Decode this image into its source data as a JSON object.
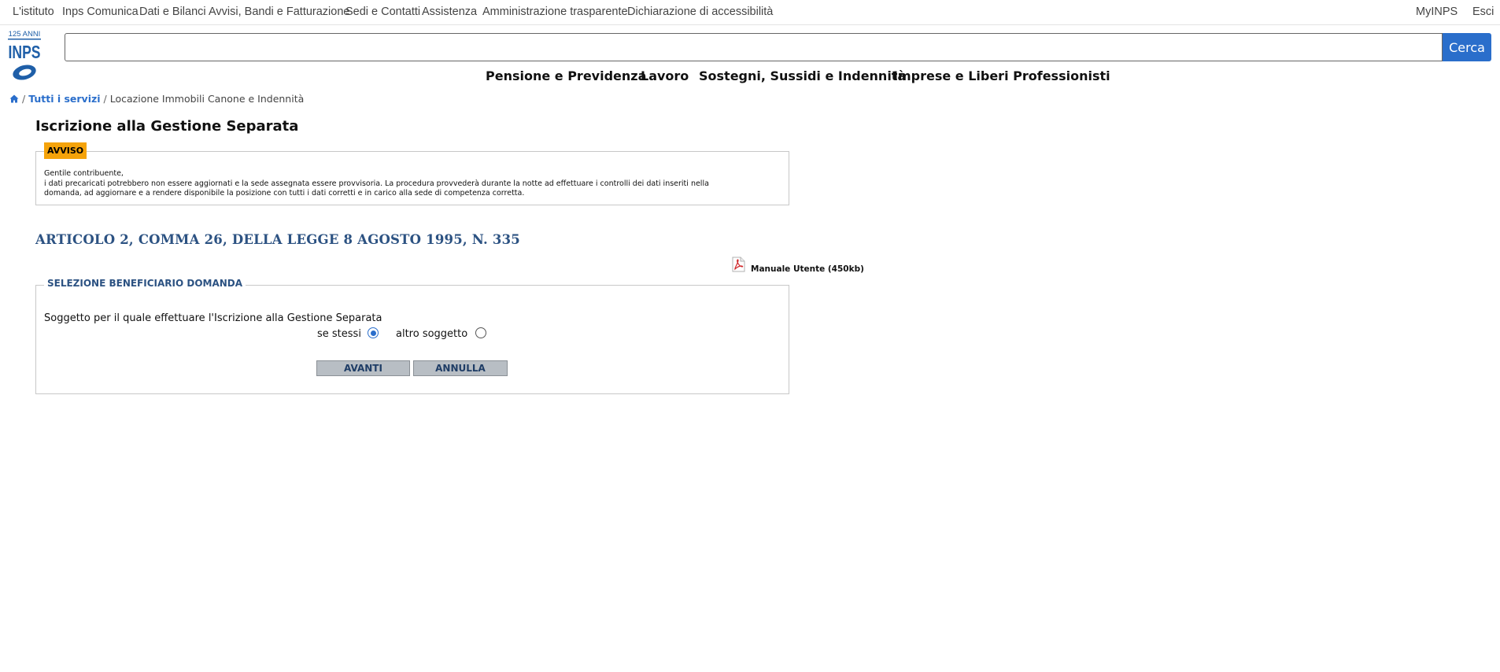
{
  "topnav": {
    "items": [
      "L'istituto",
      "Inps Comunica",
      "Dati e Bilanci",
      "Avvisi, Bandi e Fatturazione",
      "Sedi e Contatti",
      "Assistenza",
      "Amministrazione trasparente",
      "Dichiarazione di accessibilità"
    ],
    "myinps": "MyINPS",
    "esci": "Esci"
  },
  "logo": {
    "anniversary": "125 ANNI",
    "brand": "INPS",
    "color": "#1f5fa8"
  },
  "search": {
    "value": "",
    "button_label": "Cerca"
  },
  "mainnav": {
    "items": [
      "Pensione e Previdenza",
      "Lavoro",
      "Sostegni, Sussidi e Indennità",
      "Imprese e Liberi Professionisti"
    ]
  },
  "breadcrumb": {
    "home_icon": "home-icon",
    "link": "Tutti i servizi",
    "current": "Locazione Immobili Canone e Indennità",
    "separator": "/"
  },
  "page": {
    "title": "Iscrizione alla Gestione Separata"
  },
  "avviso": {
    "legend": "AVVISO",
    "greeting": "Gentile contribuente,",
    "line1": "i dati precaricati potrebbero non essere aggiornati e la sede assegnata essere provvisoria. La procedura provvederà durante la notte ad effettuare i controlli dei dati inseriti nella",
    "line2": "domanda, ad aggiornare e a rendere disponibile la posizione con tutti i dati corretti e in carico alla sede di competenza corretta."
  },
  "article": {
    "title": "ARTICOLO 2, COMMA 26, DELLA LEGGE 8 AGOSTO 1995, N. 335"
  },
  "manual": {
    "label": "Manuale Utente (450kb)",
    "icon": "pdf-icon"
  },
  "selezione": {
    "legend": "SELEZIONE BENEFICIARIO DOMANDA",
    "question": "Soggetto per il quale effettuare l'Iscrizione alla Gestione Separata",
    "options": [
      {
        "label": "se stessi",
        "checked": true
      },
      {
        "label": "altro soggetto",
        "checked": false
      }
    ],
    "avanti_label": "AVANTI",
    "annulla_label": "ANNULLA"
  },
  "colors": {
    "accent_blue": "#2a6ecb",
    "heading_blue": "#2c5282",
    "avviso_orange": "#f5a30a",
    "button_gray": "#b8bec4"
  }
}
